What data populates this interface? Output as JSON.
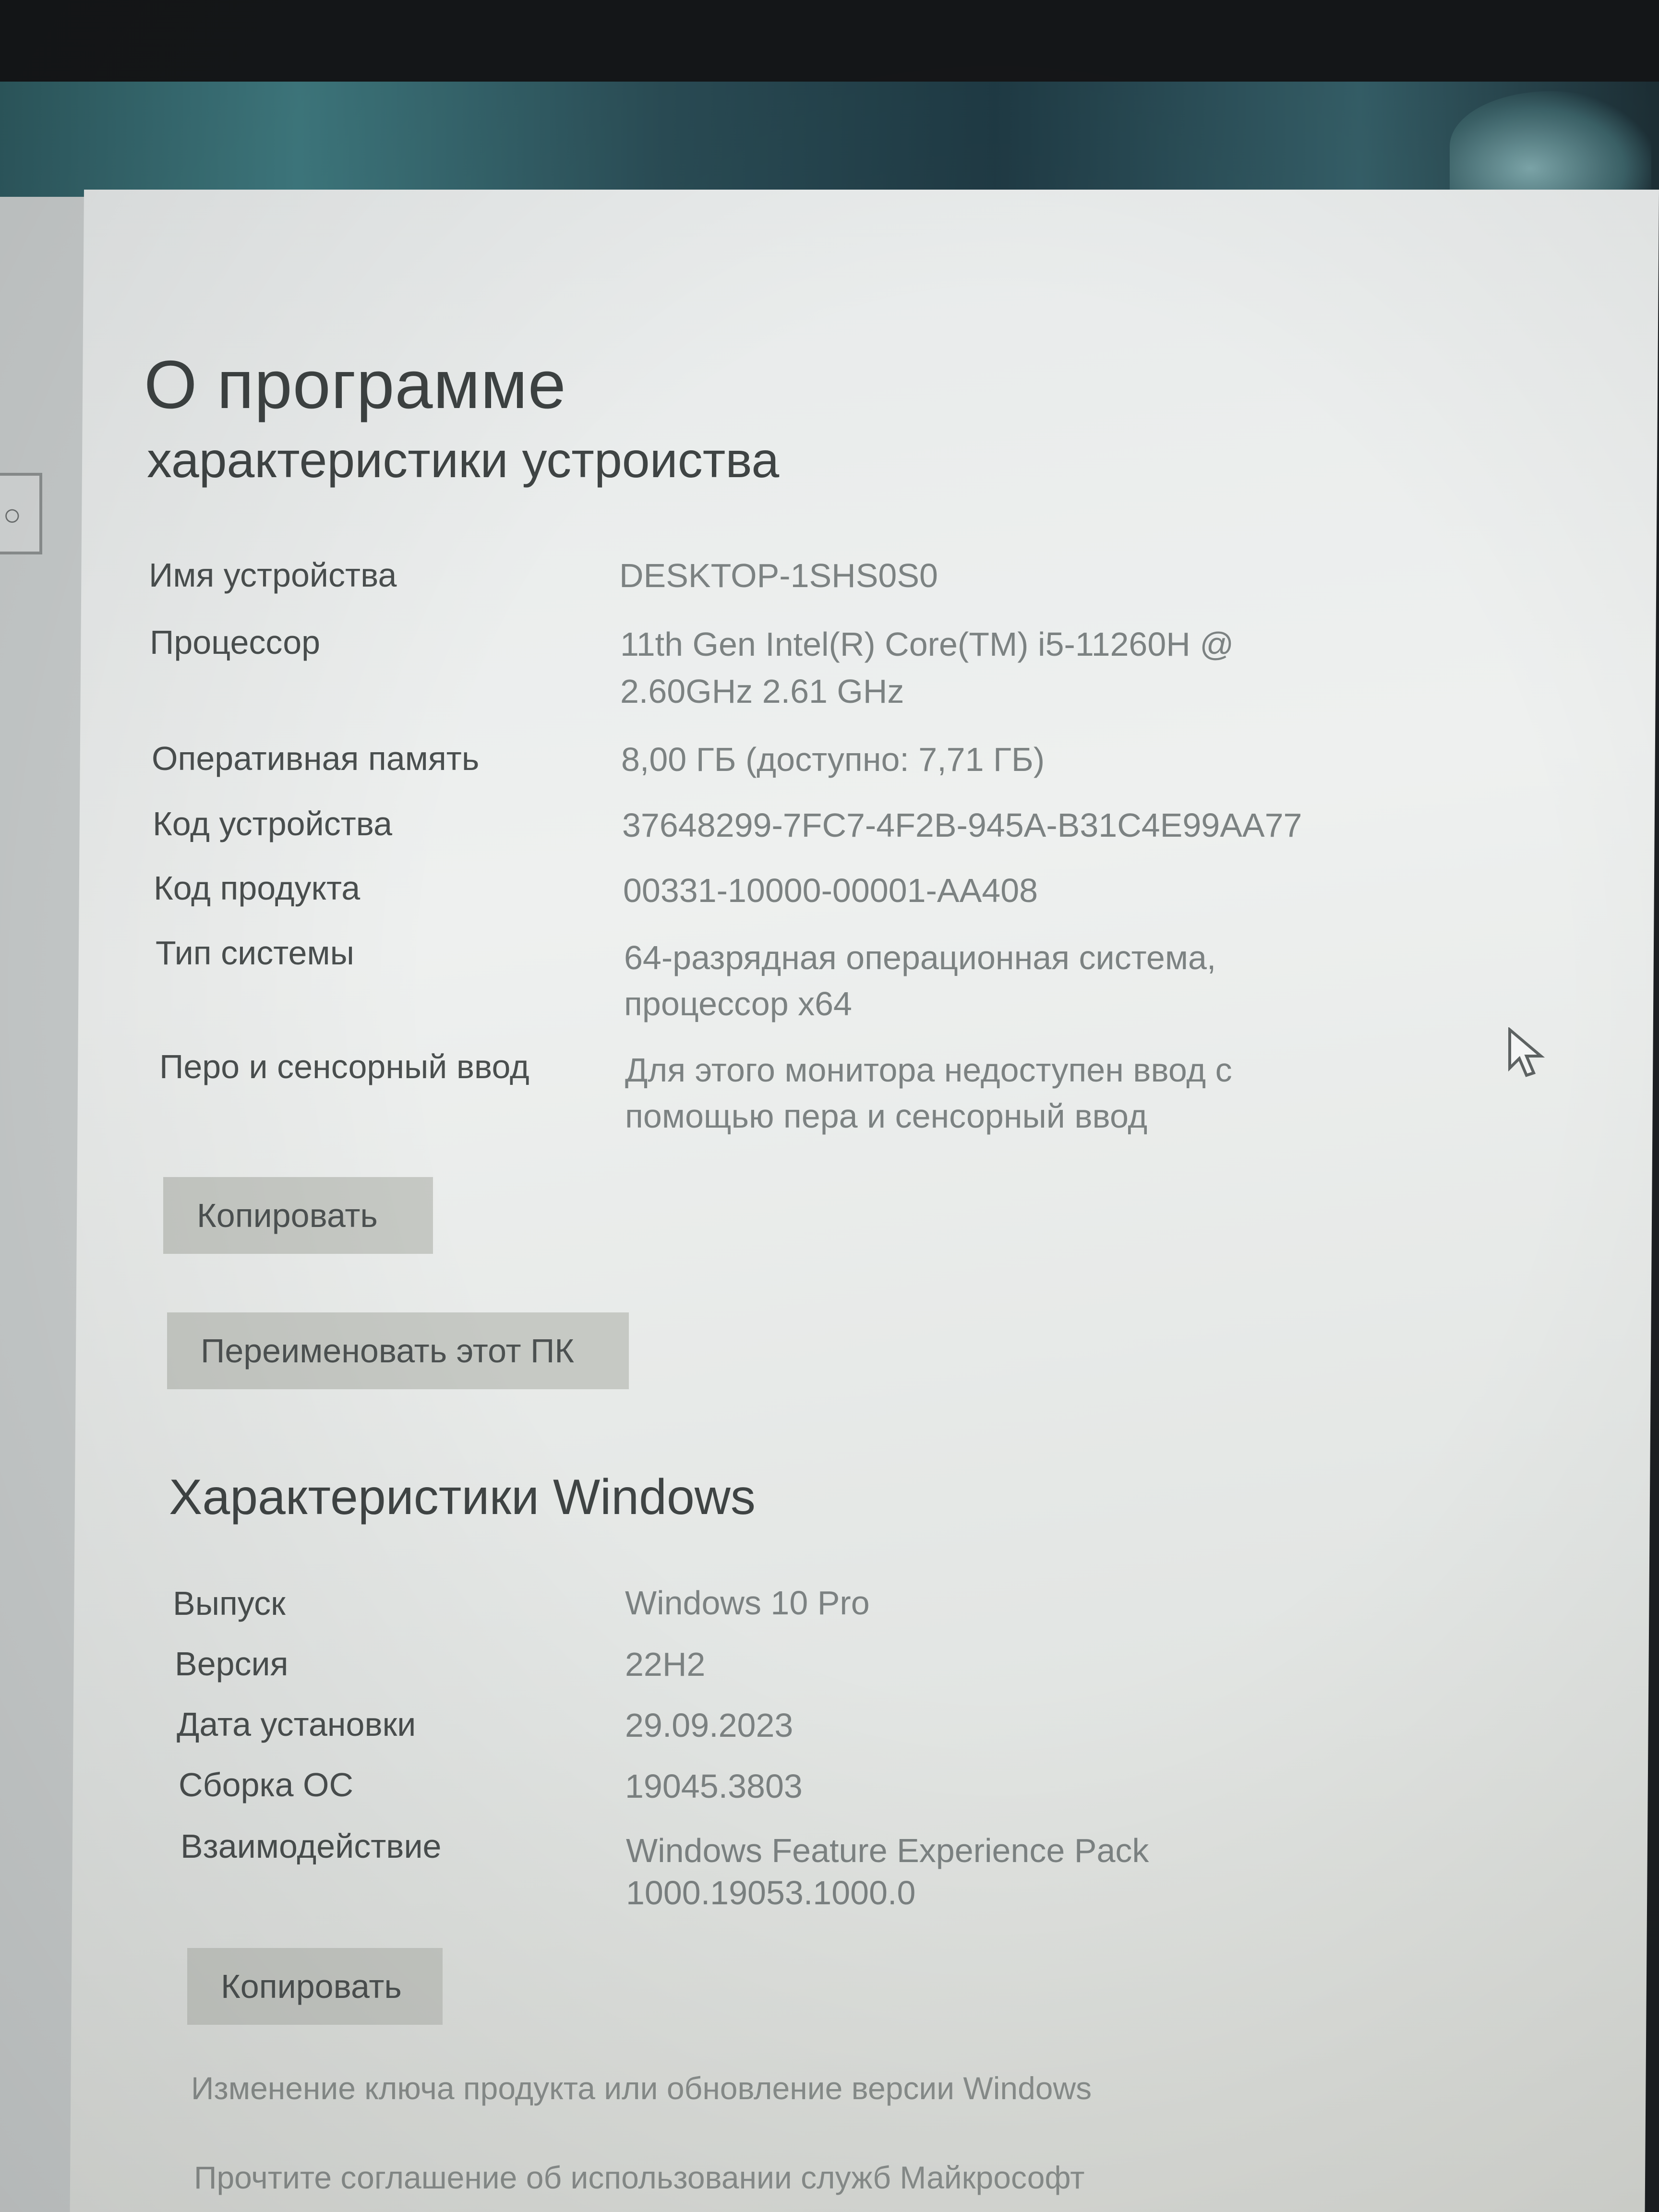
{
  "page": {
    "title": "О программе"
  },
  "device_specs": {
    "heading": "характеристики устроиства",
    "rows": [
      {
        "label": "Имя устройства",
        "value": "DESKTOP-1SHS0S0"
      },
      {
        "label": "Процессор",
        "value": "11th Gen Intel(R) Core(TM) i5-11260H @",
        "value_line2": "2.60GHz   2.61 GHz"
      },
      {
        "label": "Оперативная память",
        "value": "8,00 ГБ (доступно: 7,71 ГБ)"
      },
      {
        "label": "Код устройства",
        "value": "37648299-7FC7-4F2B-945A-B31C4E99AA77"
      },
      {
        "label": "Код продукта",
        "value": "00331-10000-00001-AA408"
      },
      {
        "label": "Тип системы",
        "value": "64-разрядная операционная система,",
        "value_line2": "процессор x64"
      },
      {
        "label": "Перо и сенсорный ввод",
        "value": "Для этого монитора недоступен ввод с",
        "value_line2": "помощью пера и сенсорный ввод"
      }
    ],
    "copy_button": "Копировать",
    "rename_button": "Переименовать этот ПК"
  },
  "windows_specs": {
    "heading": "Характеристики Windows",
    "rows": [
      {
        "label": "Выпуск",
        "value": "Windows 10 Pro"
      },
      {
        "label": "Версия",
        "value": "22H2"
      },
      {
        "label": "Дата установки",
        "value": "29.09.2023"
      },
      {
        "label": "Сборка ОС",
        "value": "19045.3803"
      },
      {
        "label": "Взаимодействие",
        "value": "Windows Feature Experience Pack",
        "value_line2": "1000.19053.1000.0"
      }
    ],
    "copy_button": "Копировать",
    "links": {
      "change_key": "Изменение ключа продукта или обновление версии Windows",
      "agreement": "Прочтите соглашение об использовании служб Майкрософт"
    }
  },
  "sidebar": {
    "search_glyph": "○"
  },
  "icons": {
    "cursor": "mouse-pointer-icon",
    "search": "search-icon"
  },
  "colors": {
    "pane_bg": "#e9ecec",
    "label_text": "#4a4f4f",
    "value_text": "#7c8282",
    "button_bg": "#c6c9c4"
  }
}
